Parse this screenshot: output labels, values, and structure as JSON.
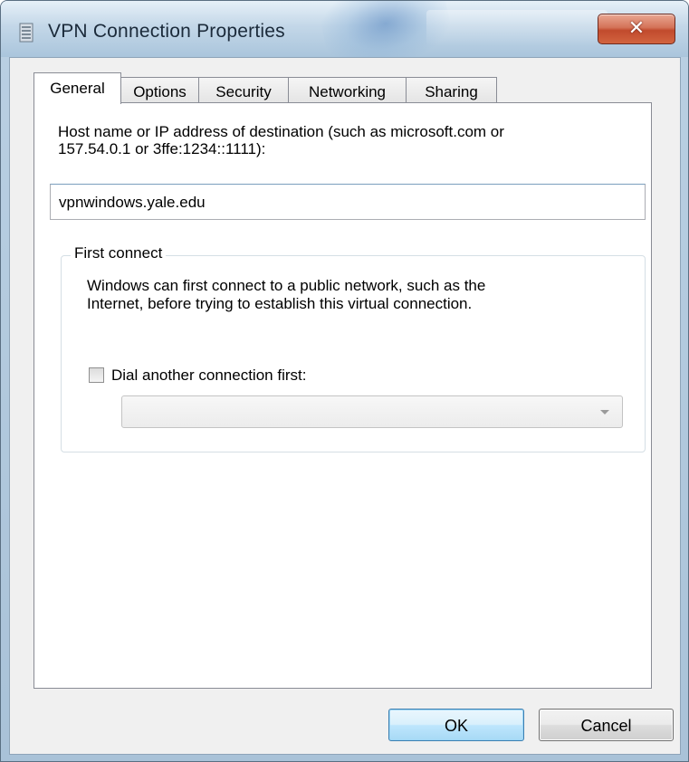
{
  "window": {
    "title": "VPN Connection Properties",
    "close_label": "✕"
  },
  "tabs": [
    {
      "label": "General",
      "active": true
    },
    {
      "label": "Options",
      "active": false
    },
    {
      "label": "Security",
      "active": false
    },
    {
      "label": "Networking",
      "active": false
    },
    {
      "label": "Sharing",
      "active": false
    }
  ],
  "general": {
    "host_description_line1": "Host name or IP address of destination (such as microsoft.com or",
    "host_description_line2": "157.54.0.1 or 3ffe:1234::1111):",
    "host_value": "vpnwindows.yale.edu",
    "first_connect": {
      "legend": "First connect",
      "text_line1": "Windows can first connect to a public network, such as the",
      "text_line2": "Internet, before trying to establish this virtual connection.",
      "checkbox_label": "Dial another connection first:",
      "checkbox_checked": false,
      "dropdown_value": ""
    }
  },
  "buttons": {
    "ok": "OK",
    "cancel": "Cancel"
  },
  "colors": {
    "close_button": "#c14a2d",
    "ok_border": "#3c7fb1"
  }
}
